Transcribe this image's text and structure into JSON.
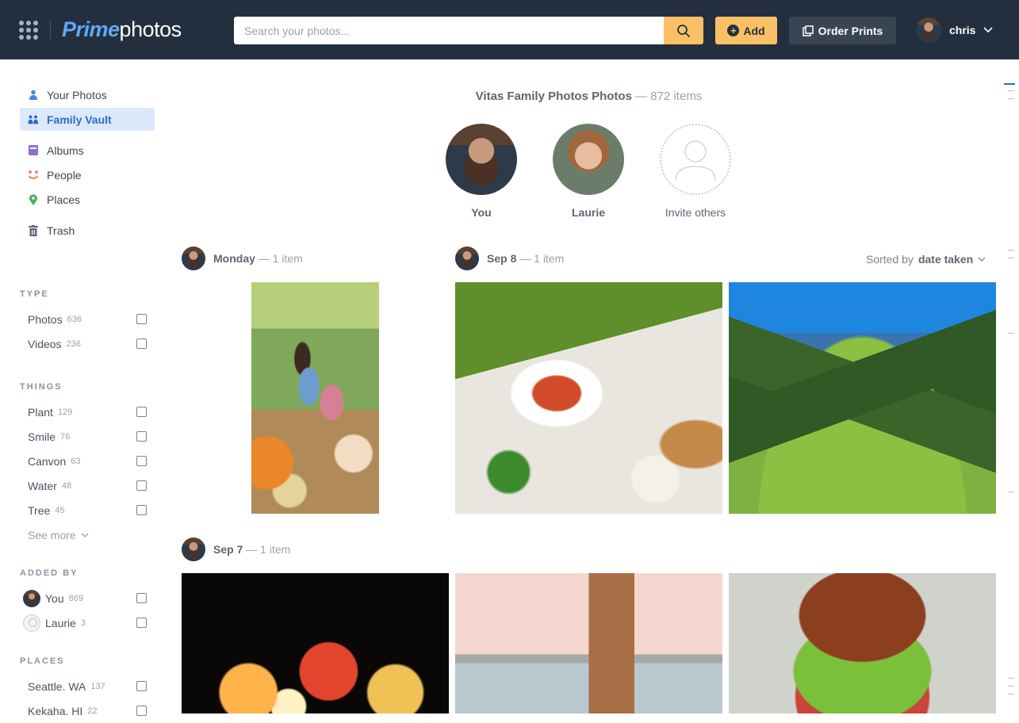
{
  "header": {
    "logo_prime": "Prime",
    "logo_photos": "photos",
    "search_placeholder": "Search your photos...",
    "add_label": "Add",
    "prints_label": "Order Prints",
    "user_name": "chris",
    "brand_color": "#232f3e",
    "accent_color": "#fbc066"
  },
  "sidebar": {
    "nav": [
      {
        "label": "Your Photos",
        "icon": "person-icon"
      },
      {
        "label": "Family Vault",
        "icon": "family-icon",
        "active": true
      },
      {
        "label": "Albums",
        "icon": "album-icon"
      },
      {
        "label": "People",
        "icon": "smile-icon"
      },
      {
        "label": "Places",
        "icon": "pin-icon"
      },
      {
        "label": "Trash",
        "icon": "trash-icon"
      }
    ],
    "filters": {
      "type": {
        "title": "TYPE",
        "items": [
          {
            "label": "Photos",
            "count": "636"
          },
          {
            "label": "Videos",
            "count": "236"
          }
        ]
      },
      "things": {
        "title": "THINGS",
        "items": [
          {
            "label": "Plant",
            "count": "129"
          },
          {
            "label": "Smile",
            "count": "76"
          },
          {
            "label": "Canvon",
            "count": "63"
          },
          {
            "label": "Water",
            "count": "48"
          },
          {
            "label": "Tree",
            "count": "45"
          }
        ],
        "see_more": "See more"
      },
      "added_by": {
        "title": "ADDED BY",
        "items": [
          {
            "label": "You",
            "count": "869"
          },
          {
            "label": "Laurie",
            "count": "3"
          }
        ]
      },
      "places": {
        "title": "PLACES",
        "items": [
          {
            "label": "Seattle. WA",
            "count": "137"
          },
          {
            "label": "Kekaha. HI",
            "count": "22"
          }
        ]
      }
    }
  },
  "main": {
    "vault_name": "Vitas Family Photos Photos",
    "vault_count": "— 872 items",
    "members": [
      {
        "label": "You"
      },
      {
        "label": "Laurie"
      },
      {
        "label": "Invite others"
      }
    ],
    "sort_prefix": "Sorted by",
    "sort_value": "date taken",
    "groups": [
      {
        "date": "Monday",
        "items": "— 1 item"
      },
      {
        "date": "Sep 8",
        "items": "— 1 item"
      },
      {
        "date": "Sep 7",
        "items": "— 1 item"
      }
    ]
  }
}
